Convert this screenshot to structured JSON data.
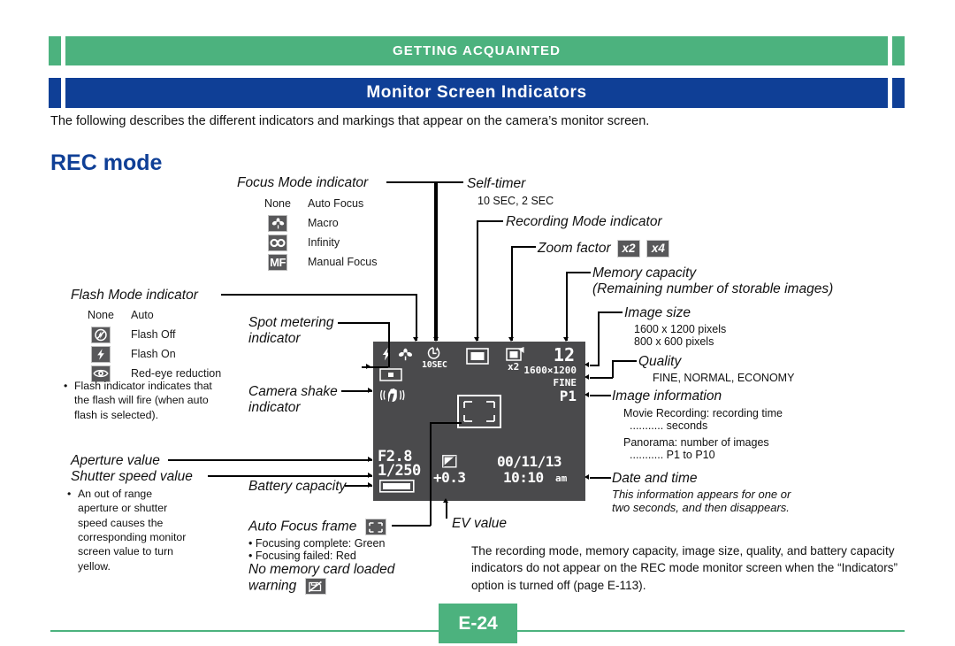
{
  "header": {
    "section": "GETTING ACQUAINTED",
    "title": "Monitor Screen Indicators",
    "intro": "The following describes the different indicators and markings that appear on the camera’s monitor screen.",
    "green": "#4cb27e",
    "blue": "#0f3f96"
  },
  "rec_mode_heading": "REC mode",
  "focus_mode": {
    "label": "Focus Mode indicator",
    "rows": [
      {
        "key": "None",
        "icon": "",
        "value": "Auto Focus"
      },
      {
        "key": "",
        "icon": "macro-flower-icon",
        "value": "Macro"
      },
      {
        "key": "",
        "icon": "infinity-icon",
        "value": "Infinity"
      },
      {
        "key": "",
        "icon": "manual-focus-mf-icon",
        "value": "Manual Focus"
      }
    ]
  },
  "flash_mode": {
    "label": "Flash Mode indicator",
    "rows": [
      {
        "key": "None",
        "icon": "",
        "value": "Auto"
      },
      {
        "key": "",
        "icon": "flash-off-icon",
        "value": "Flash Off"
      },
      {
        "key": "",
        "icon": "flash-on-icon",
        "value": "Flash On"
      },
      {
        "key": "",
        "icon": "red-eye-reduction-icon",
        "value": "Red-eye reduction"
      }
    ],
    "note": "Flash indicator indicates that the flash will fire (when auto flash is selected)."
  },
  "spot_metering": {
    "line1": "Spot metering",
    "line2": "indicator"
  },
  "camera_shake": {
    "line1": "Camera shake",
    "line2": "indicator"
  },
  "aperture": {
    "label": "Aperture value"
  },
  "shutter": {
    "label": "Shutter speed value",
    "note": "An out of range aperture or shutter speed causes the corresponding monitor screen value to turn yellow."
  },
  "battery": {
    "label": "Battery capacity"
  },
  "auto_focus_frame": {
    "label": "Auto Focus frame",
    "icon": "af-frame-icon",
    "bullets": [
      "Focusing complete: Green",
      "Focusing failed: Red"
    ]
  },
  "no_card_warning": {
    "line1": "No memory card loaded",
    "line2": "warning",
    "icon": "no-memory-card-icon"
  },
  "self_timer": {
    "label": "Self-timer",
    "detail": "10 SEC, 2 SEC"
  },
  "recording_mode": {
    "label": "Recording Mode indicator"
  },
  "zoom_factor": {
    "label": "Zoom factor",
    "options": [
      "x2",
      "x4"
    ]
  },
  "memory_capacity": {
    "label": "Memory capacity",
    "detail": "(Remaining number of storable images)"
  },
  "image_size": {
    "label": "Image size",
    "details": [
      "1600 x 1200 pixels",
      "800 x 600 pixels"
    ]
  },
  "quality": {
    "label": "Quality",
    "detail": "FINE, NORMAL, ECONOMY"
  },
  "image_information": {
    "label": "Image information",
    "details": [
      "Movie Recording: recording time",
      "........... seconds",
      "Panorama: number of images",
      "........... P1 to P10"
    ]
  },
  "date_time": {
    "label": "Date and time",
    "note_line1": "This information appears for one or",
    "note_line2": "two seconds, and then disappears."
  },
  "ev_value": {
    "label": "EV value"
  },
  "bottom_note": "The recording mode, memory capacity, image size, quality, and battery capacity indicators do not appear on the REC mode monitor screen when the “Indicators” option is turned off (page E-113).",
  "monitor": {
    "background": "#4a4a4c",
    "self_timer_text": "10SEC",
    "zoom_text": "x2",
    "memory_capacity_value": "12",
    "image_size_value": "1600×1200",
    "quality_value": "FINE",
    "image_info_value": "P1",
    "aperture_value": "F2.8",
    "shutter_value": "1/250",
    "ev_value": "+0.3",
    "date_value": "00/11/13",
    "time_value": "10:10",
    "time_ampm": "am"
  },
  "footer": {
    "page": "E-24"
  }
}
